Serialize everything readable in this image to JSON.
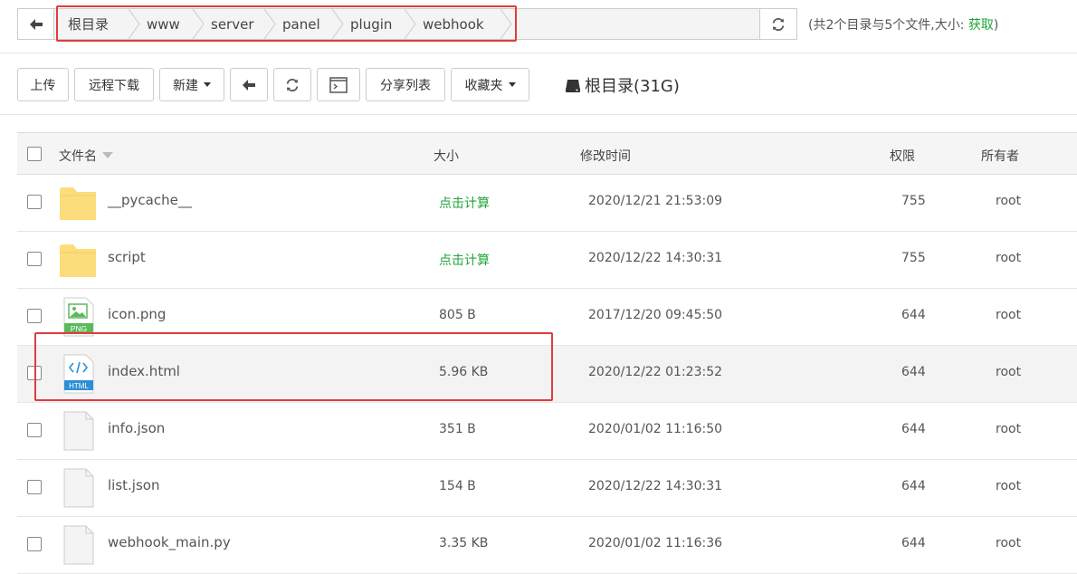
{
  "path_bar": {
    "crumbs": [
      "根目录",
      "www",
      "server",
      "panel",
      "plugin",
      "webhook"
    ],
    "summary_prefix": "(共2个目录与5个文件,大小: ",
    "summary_link": "获取",
    "summary_suffix": ")"
  },
  "toolbar": {
    "upload": "上传",
    "remote_download": "远程下载",
    "new_menu": "新建",
    "share_list": "分享列表",
    "favorites": "收藏夹",
    "disk_label": "根目录(31G)"
  },
  "table": {
    "headers": {
      "name": "文件名",
      "size": "大小",
      "mtime": "修改时间",
      "permission": "权限",
      "owner": "所有者"
    },
    "rows": [
      {
        "icon": "folder-icon",
        "name": "__pycache__",
        "size": "点击计算",
        "mtime": "2020/12/21 21:53:09",
        "permission": "755",
        "owner": "root"
      },
      {
        "icon": "folder-icon",
        "name": "script",
        "size": "点击计算",
        "mtime": "2020/12/22 14:30:31",
        "permission": "755",
        "owner": "root"
      },
      {
        "icon": "png-file-icon",
        "name": "icon.png",
        "size": "805 B",
        "mtime": "2017/12/20 09:45:50",
        "permission": "644",
        "owner": "root"
      },
      {
        "icon": "html-file-icon",
        "name": "index.html",
        "size": "5.96 KB",
        "mtime": "2020/12/22 01:23:52",
        "permission": "644",
        "owner": "root"
      },
      {
        "icon": "file-icon",
        "name": "info.json",
        "size": "351 B",
        "mtime": "2020/01/02 11:16:50",
        "permission": "644",
        "owner": "root"
      },
      {
        "icon": "file-icon",
        "name": "list.json",
        "size": "154 B",
        "mtime": "2020/12/22 14:30:31",
        "permission": "644",
        "owner": "root"
      },
      {
        "icon": "file-icon",
        "name": "webhook_main.py",
        "size": "3.35 KB",
        "mtime": "2020/01/02 11:16:36",
        "permission": "644",
        "owner": "root"
      }
    ]
  },
  "colors": {
    "accent_green": "#20a53a",
    "annotation_red": "#e03c3c",
    "folder_yellow": "#fbdd7b"
  }
}
